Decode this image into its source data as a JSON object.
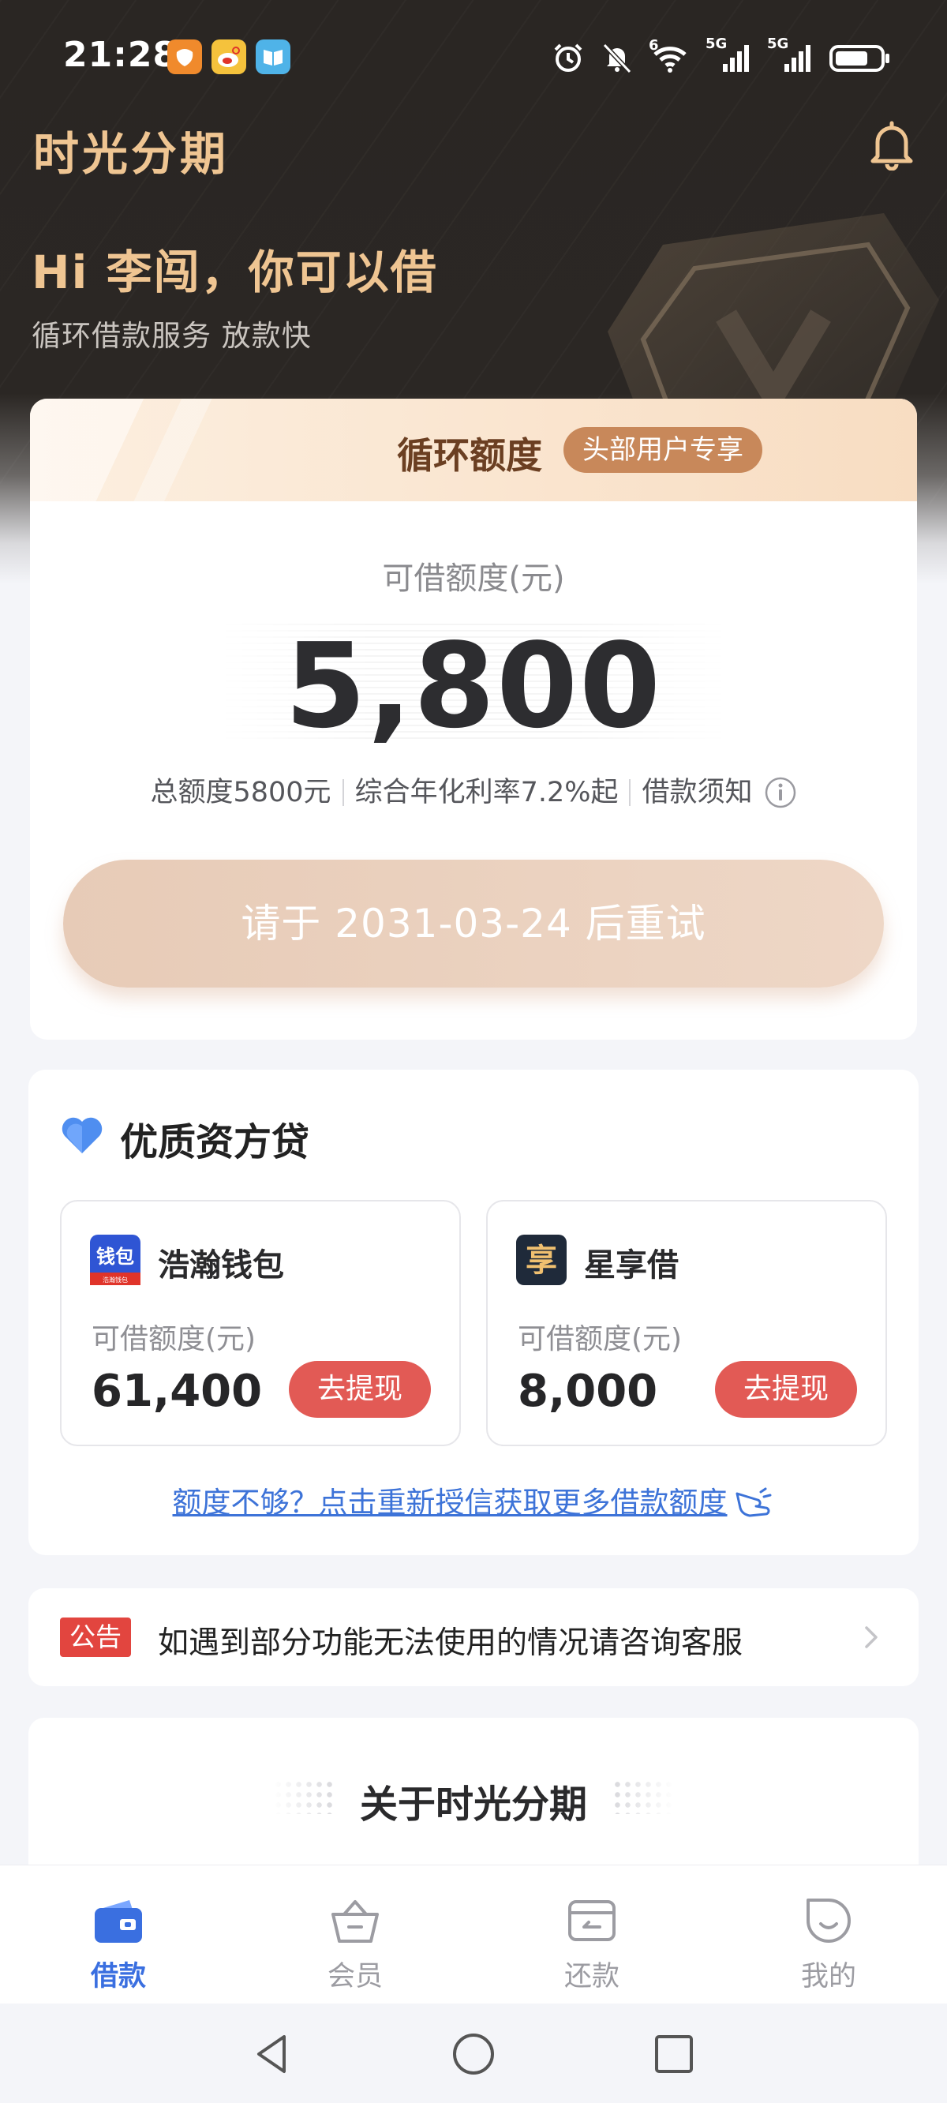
{
  "status_bar": {
    "time": "21:28",
    "notification_icons": [
      "taobao-icon",
      "weibo-icon",
      "reader-icon"
    ],
    "system_icons": [
      "alarm-icon",
      "mute-icon",
      "wifi-icon",
      "signal-5g-icon",
      "signal-5g-icon",
      "battery-icon"
    ],
    "wifi_generation": "6",
    "network_label_1": "5G",
    "network_label_2": "5G"
  },
  "header": {
    "app_title": "时光分期",
    "greeting": "Hi 李闯，你可以借",
    "subtitle": "循环借款服务 放款快"
  },
  "credit_card": {
    "title": "循环额度",
    "badge": "头部用户专享",
    "available_label": "可借额度(元)",
    "available_amount": "5,800",
    "total_limit": "总额度5800元",
    "rate": "综合年化利率7.2%起",
    "notice_link": "借款须知",
    "retry_button": "请于 2031-03-24 后重试"
  },
  "quality_loans": {
    "title": "优质资方贷",
    "lenders": [
      {
        "name": "浩瀚钱包",
        "logo_text": "钱包",
        "logo_subtext": "浩瀚钱包",
        "label": "可借额度(元)",
        "amount": "61,400",
        "button": "去提现",
        "logo_color": "#2f55d4"
      },
      {
        "name": "星享借",
        "logo_text": "享",
        "label": "可借额度(元)",
        "amount": "8,000",
        "button": "去提现",
        "logo_color": "#1f2a3a"
      }
    ],
    "more_link": "额度不够？点击重新授信获取更多借款额度"
  },
  "notice": {
    "tag": "公告",
    "text": "如遇到部分功能无法使用的情况请咨询客服"
  },
  "about": {
    "title": "关于时光分期"
  },
  "tabbar": {
    "items": [
      {
        "label": "借款",
        "icon": "wallet-icon",
        "active": true
      },
      {
        "label": "会员",
        "icon": "member-basket-icon",
        "active": false
      },
      {
        "label": "还款",
        "icon": "repay-card-icon",
        "active": false
      },
      {
        "label": "我的",
        "icon": "profile-face-icon",
        "active": false
      }
    ]
  },
  "colors": {
    "accent_gold": "#efc592",
    "header_dark": "#2a2623",
    "primary_blue": "#3a6fe0",
    "withdraw_red": "#e25a55",
    "notice_red": "#e2453f"
  }
}
